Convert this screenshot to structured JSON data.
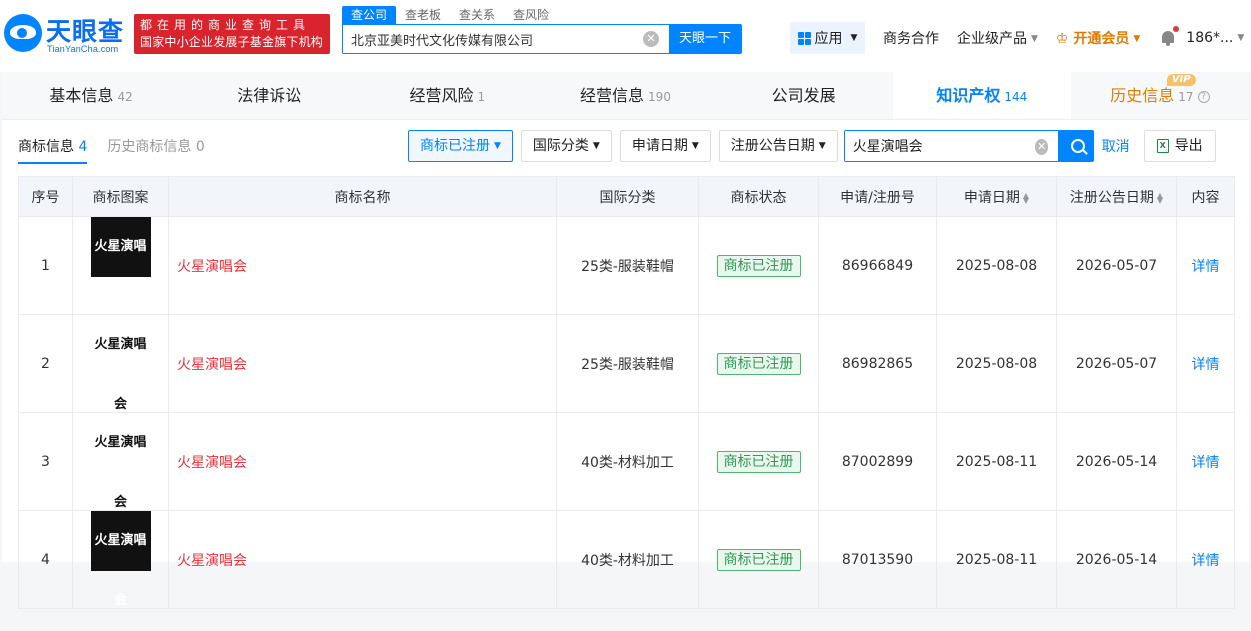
{
  "logo": {
    "name": "天眼查",
    "sub": "TianYanCha.com"
  },
  "slogan": {
    "line1": "都在用的商业查询工具",
    "line2": "国家中小企业发展子基金旗下机构"
  },
  "search_tabs": [
    "查公司",
    "查老板",
    "查关系",
    "查风险"
  ],
  "search": {
    "value": "北京亚美时代文化传媒有限公司",
    "button": "天眼一下"
  },
  "nav": {
    "app": "应用",
    "cooperation": "商务合作",
    "enterprise": "企业级产品",
    "vip": "开通会员",
    "user": "186*..."
  },
  "main_tabs": [
    {
      "label": "基本信息",
      "count": "42"
    },
    {
      "label": "法律诉讼",
      "count": ""
    },
    {
      "label": "经营风险",
      "count": "1"
    },
    {
      "label": "经营信息",
      "count": "190"
    },
    {
      "label": "公司发展",
      "count": ""
    },
    {
      "label": "知识产权",
      "count": "144"
    },
    {
      "label": "历史信息",
      "count": "17"
    }
  ],
  "vip_badge": "VIP",
  "sub_tabs": [
    {
      "label": "商标信息",
      "count": "4"
    },
    {
      "label": "历史商标信息",
      "count": "0"
    }
  ],
  "filters": {
    "status": "商标已注册",
    "intl_class": "国际分类",
    "apply_date": "申请日期",
    "notice_date": "注册公告日期"
  },
  "filter_search": {
    "value": "火星演唱会"
  },
  "cancel": "取消",
  "export": "导出",
  "columns": [
    "序号",
    "商标图案",
    "商标名称",
    "国际分类",
    "商标状态",
    "申请/注册号",
    "申请日期",
    "注册公告日期",
    "内容"
  ],
  "rows": [
    {
      "no": "1",
      "img_text": "火星演唱会",
      "img_style": "dark",
      "name": "火星演唱会",
      "cls": "25类-服装鞋帽",
      "status": "商标已注册",
      "reg": "86966849",
      "apply": "2025-08-08",
      "notice": "2026-05-07",
      "detail": "详情"
    },
    {
      "no": "2",
      "img_text": "火星演唱会",
      "img_style": "light",
      "name": "火星演唱会",
      "cls": "25类-服装鞋帽",
      "status": "商标已注册",
      "reg": "86982865",
      "apply": "2025-08-08",
      "notice": "2026-05-07",
      "detail": "详情"
    },
    {
      "no": "3",
      "img_text": "火星演唱会",
      "img_style": "light",
      "name": "火星演唱会",
      "cls": "40类-材料加工",
      "status": "商标已注册",
      "reg": "87002899",
      "apply": "2025-08-11",
      "notice": "2026-05-14",
      "detail": "详情"
    },
    {
      "no": "4",
      "img_text": "火星演唱会",
      "img_style": "dark",
      "name": "火星演唱会",
      "cls": "40类-材料加工",
      "status": "商标已注册",
      "reg": "87013590",
      "apply": "2025-08-11",
      "notice": "2026-05-14",
      "detail": "详情"
    }
  ]
}
